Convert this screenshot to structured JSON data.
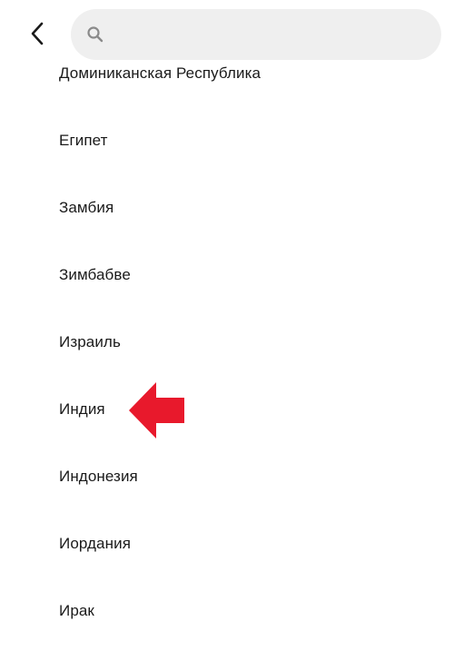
{
  "header": {
    "back_icon": "chevron-left-icon",
    "search_icon": "search-icon",
    "search_value": "",
    "search_placeholder": ""
  },
  "countries": [
    "Доминиканская Республика",
    "Египет",
    "Замбия",
    "Зимбабве",
    "Израиль",
    "Индия",
    "Индонезия",
    "Иордания",
    "Ирак"
  ],
  "annotation": {
    "icon": "red-arrow-left-icon",
    "color": "#e8192c",
    "points_to": "Индия"
  },
  "colors": {
    "search_background": "#efefef",
    "text": "#1a1a1a"
  }
}
